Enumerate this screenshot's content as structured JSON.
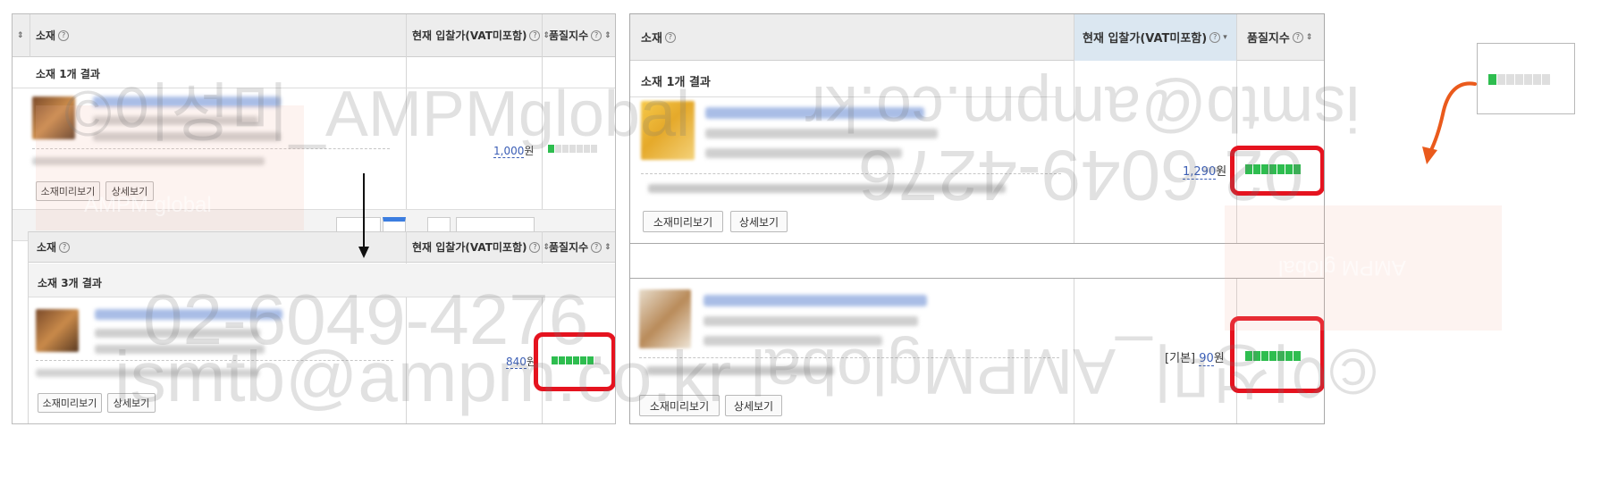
{
  "left": {
    "top_table": {
      "col_ad": "소재",
      "col_bid": "현재 입찰가(VAT미포함)",
      "col_quality": "품질지수",
      "result_text": "소재 1개 결과",
      "preview_button": "소재미리보기",
      "detail_button": "상세보기",
      "bid_amount": "1,000",
      "bid_unit": "원",
      "quality_level": 1,
      "quality_max": 7
    },
    "bottom_table": {
      "col_ad": "소재",
      "col_bid": "현재 입찰가(VAT미포함)",
      "col_quality": "품질지수",
      "result_text": "소재 3개 결과",
      "preview_button": "소재미리보기",
      "detail_button": "상세보기",
      "bid_amount": "840",
      "bid_unit": "원",
      "quality_level": 6,
      "quality_max": 7
    }
  },
  "right": {
    "col_ad": "소재",
    "col_bid": "현재 입찰가(VAT미포함)",
    "col_quality": "품질지수",
    "result_text": "소재 1개 결과",
    "row1": {
      "preview_button": "소재미리보기",
      "detail_button": "상세보기",
      "bid_amount": "1,290",
      "bid_unit": "원",
      "quality_level": 7,
      "quality_max": 7
    },
    "row2": {
      "preview_button": "소재미리보기",
      "detail_button": "상세보기",
      "bid_prefix": "[기본]",
      "bid_amount": "90",
      "bid_unit": "원",
      "quality_level": 7,
      "quality_max": 7
    },
    "callout_quality_level": 1,
    "callout_quality_max": 7
  },
  "watermark": {
    "line1": "©이성미_AMPMglobal",
    "line2": "02-6049-4276",
    "line3": "ismtb@ampm.co.kr",
    "logo": "AMPM global"
  },
  "colors": {
    "highlight": "#e5131f",
    "quality_on": "#2ebd4f",
    "quality_off": "#dedede",
    "link": "#3a5db5",
    "arrow_orange": "#ea5a1c"
  }
}
